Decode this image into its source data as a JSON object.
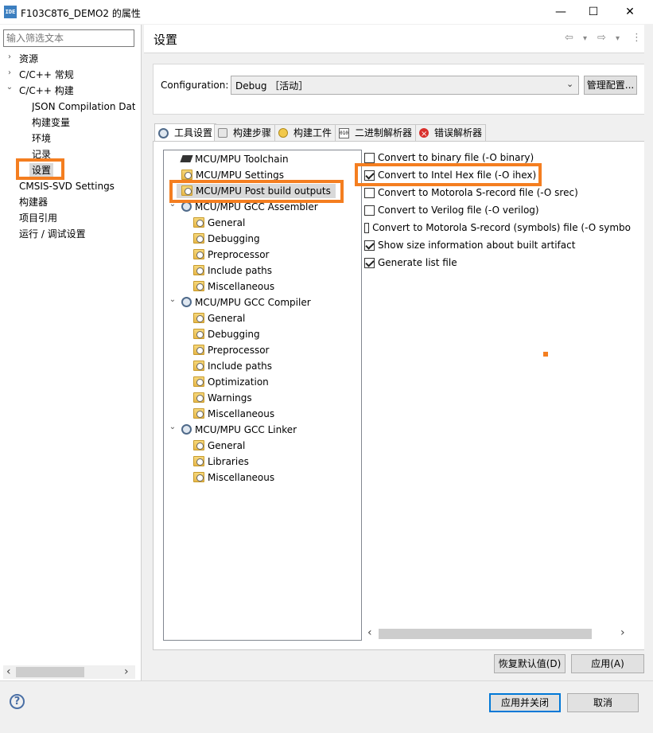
{
  "window": {
    "app_icon_text": "IDE",
    "title": "F103C8T6_DEMO2 的属性",
    "minimize": "—",
    "maximize": "☐",
    "close": "✕"
  },
  "filter": {
    "placeholder": "输入筛选文本"
  },
  "left_tree": [
    {
      "label": "资源",
      "arrow": "›"
    },
    {
      "label": "C/C++ 常规",
      "arrow": "›"
    },
    {
      "label": "C/C++ 构建",
      "arrow": "⌄"
    },
    {
      "label": "JSON Compilation Dat"
    },
    {
      "label": "构建变量"
    },
    {
      "label": "环境"
    },
    {
      "label": "记录"
    },
    {
      "label": "设置"
    },
    {
      "label": "CMSIS-SVD Settings"
    },
    {
      "label": "构建器"
    },
    {
      "label": "项目引用"
    },
    {
      "label": "运行 / 调试设置"
    }
  ],
  "page": {
    "title": "设置",
    "back": "⇦",
    "forward": "⇨",
    "dropdown": "▾",
    "menu": "⋮"
  },
  "configuration": {
    "label": "Configuration:",
    "value": "Debug ［活动］",
    "caret": "⌄",
    "manage_button": "管理配置..."
  },
  "tabs": [
    {
      "label": "工具设置",
      "icon": "tool-settings-icon"
    },
    {
      "label": "构建步骤",
      "icon": "build-steps-icon"
    },
    {
      "label": "构建工件",
      "icon": "build-artifact-icon"
    },
    {
      "label": "二进制解析器",
      "icon": "binary-parser-icon"
    },
    {
      "label": "错误解析器",
      "icon": "error-parser-icon"
    }
  ],
  "tool_tree": [
    {
      "label": "MCU/MPU Toolchain",
      "icon": "chip"
    },
    {
      "label": "MCU/MPU Settings",
      "icon": "folder"
    },
    {
      "label": "MCU/MPU Post build outputs",
      "icon": "folder"
    },
    {
      "label": "MCU/MPU GCC Assembler",
      "icon": "gear",
      "arrow": "⌄"
    },
    {
      "label": "General",
      "icon": "folder"
    },
    {
      "label": "Debugging",
      "icon": "folder"
    },
    {
      "label": "Preprocessor",
      "icon": "folder"
    },
    {
      "label": "Include paths",
      "icon": "folder"
    },
    {
      "label": "Miscellaneous",
      "icon": "folder"
    },
    {
      "label": "MCU/MPU GCC Compiler",
      "icon": "gear",
      "arrow": "⌄"
    },
    {
      "label": "General",
      "icon": "folder"
    },
    {
      "label": "Debugging",
      "icon": "folder"
    },
    {
      "label": "Preprocessor",
      "icon": "folder"
    },
    {
      "label": "Include paths",
      "icon": "folder"
    },
    {
      "label": "Optimization",
      "icon": "folder"
    },
    {
      "label": "Warnings",
      "icon": "folder"
    },
    {
      "label": "Miscellaneous",
      "icon": "folder"
    },
    {
      "label": "MCU/MPU GCC Linker",
      "icon": "gear",
      "arrow": "⌄"
    },
    {
      "label": "General",
      "icon": "folder"
    },
    {
      "label": "Libraries",
      "icon": "folder"
    },
    {
      "label": "Miscellaneous",
      "icon": "folder"
    }
  ],
  "options": [
    {
      "label": "Convert to binary file (-O binary)",
      "checked": false
    },
    {
      "label": "Convert to Intel Hex file (-O ihex)",
      "checked": true
    },
    {
      "label": "Convert to Motorola S-record file (-O srec)",
      "checked": false
    },
    {
      "label": "Convert to Verilog file (-O verilog)",
      "checked": false
    },
    {
      "label": "Convert to Motorola S-record (symbols) file (-O symbo",
      "checked": false
    },
    {
      "label": "Show size information about built artifact",
      "checked": true
    },
    {
      "label": "Generate list file",
      "checked": true
    }
  ],
  "scroll": {
    "left": "‹",
    "right": "›"
  },
  "buttons": {
    "restore_defaults": "恢复默认值(D)",
    "apply": "应用(A)",
    "apply_close": "应用并关闭",
    "cancel": "取消",
    "help": "?"
  },
  "highlight_color": "#f47e20"
}
